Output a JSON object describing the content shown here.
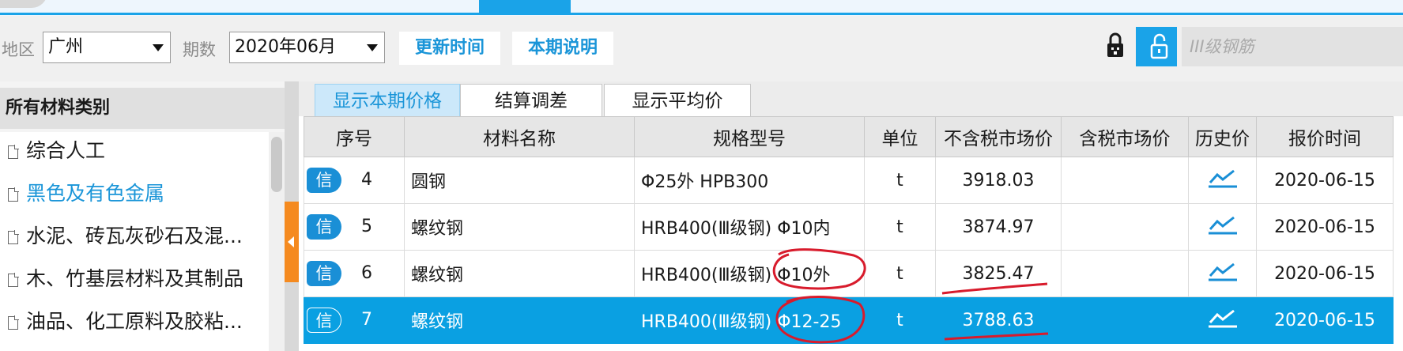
{
  "filters": {
    "region_label": "地区",
    "region_value": "广州",
    "period_label": "期数",
    "period_value": "2020年06月",
    "update_time_label": "更新时间",
    "period_note_label": "本期说明",
    "search_placeholder": "III级钢筋"
  },
  "sidebar": {
    "title": "所有材料类别",
    "items": [
      {
        "label": "综合人工"
      },
      {
        "label": "黑色及有色金属",
        "active": true
      },
      {
        "label": "水泥、砖瓦灰砂石及混..."
      },
      {
        "label": "木、竹基层材料及其制品"
      },
      {
        "label": "油品、化工原料及胶粘..."
      }
    ]
  },
  "tabs": [
    {
      "label": "显示本期价格",
      "active": true
    },
    {
      "label": "结算调差"
    },
    {
      "label": "显示平均价"
    }
  ],
  "table": {
    "badge_label": "信",
    "columns": [
      "序号",
      "材料名称",
      "规格型号",
      "单位",
      "不含税市场价",
      "含税市场价",
      "历史价",
      "报价时间"
    ],
    "rows": [
      {
        "seq": "4",
        "name": "圆钢",
        "spec": "Φ25外 HPB300",
        "unit": "t",
        "price_ex_tax": "3918.03",
        "price_inc_tax": "",
        "quote_date": "2020-06-15"
      },
      {
        "seq": "5",
        "name": "螺纹钢",
        "spec": "HRB400(Ⅲ级钢) Φ10内",
        "unit": "t",
        "price_ex_tax": "3874.97",
        "price_inc_tax": "",
        "quote_date": "2020-06-15"
      },
      {
        "seq": "6",
        "name": "螺纹钢",
        "spec": "HRB400(Ⅲ级钢) Φ10外",
        "unit": "t",
        "price_ex_tax": "3825.47",
        "price_inc_tax": "",
        "quote_date": "2020-06-15"
      },
      {
        "seq": "7",
        "name": "螺纹钢",
        "spec": "HRB400(Ⅲ级钢) Φ12-25",
        "unit": "t",
        "price_ex_tax": "3788.63",
        "price_inc_tax": "",
        "quote_date": "2020-06-15",
        "selected": true
      }
    ]
  },
  "colors": {
    "accent": "#1aa3e8",
    "selected_row": "#0aa0e2",
    "collapse_handle": "#f58a1f",
    "annotation": "#d81b2c"
  },
  "icons": {
    "lock_closed": "lock-icon",
    "lock_open": "unlock-icon",
    "history": "line-chart-icon",
    "file": "file-icon",
    "dropdown": "chevron-down-icon"
  }
}
